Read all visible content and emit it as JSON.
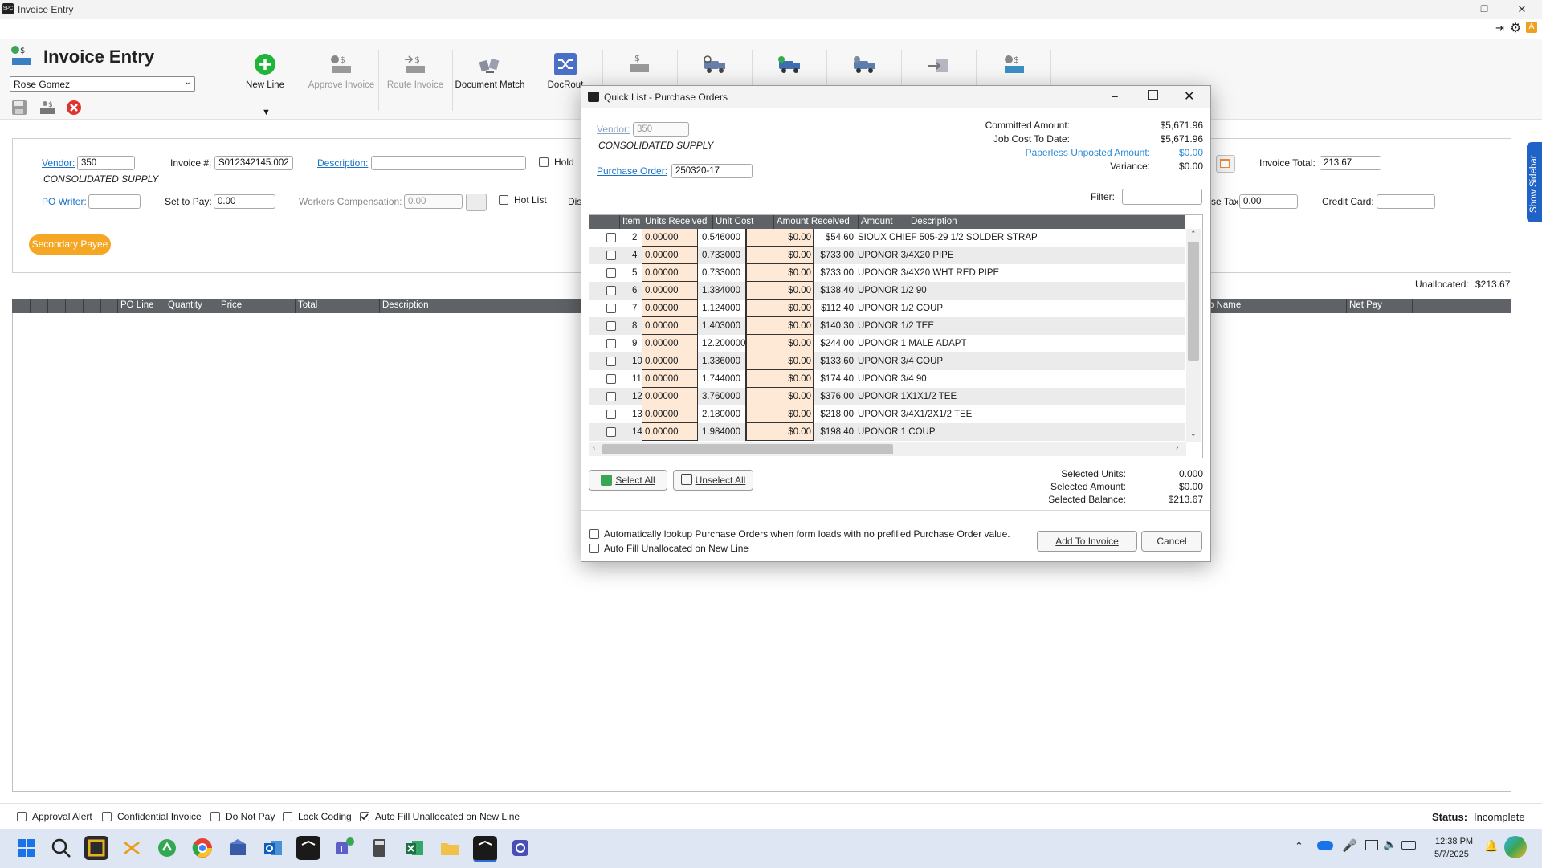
{
  "window": {
    "title": "Invoice Entry"
  },
  "header": {
    "title": "Invoice Entry",
    "user": "Rose Gomez"
  },
  "ribbon": {
    "items": [
      {
        "label": "New Line",
        "icon": "add-circle-icon",
        "enabled": true
      },
      {
        "label": "Approve Invoice",
        "icon": "approve-invoice-icon",
        "enabled": false
      },
      {
        "label": "Route Invoice",
        "icon": "route-invoice-icon",
        "enabled": false
      },
      {
        "label": "Document Match",
        "icon": "document-match-icon",
        "enabled": true
      },
      {
        "label": "DocRout",
        "icon": "shuffle-icon",
        "enabled": true
      }
    ]
  },
  "form": {
    "vendor_label": "Vendor:",
    "vendor": "350",
    "vendor_name": "CONSOLIDATED SUPPLY",
    "invoice_no_label": "Invoice #:",
    "invoice_no": "S012342145.002",
    "description_label": "Description:",
    "description": "",
    "hold_label": "Hold",
    "po_writer_label": "PO Writer:",
    "po_writer": "",
    "set_to_pay_label": "Set to Pay:",
    "set_to_pay": "0.00",
    "workers_comp_label": "Workers Compensation:",
    "workers_comp": "0.00",
    "hot_list_label": "Hot List",
    "dis_label": "Dis",
    "invoice_total_label": "Invoice Total:",
    "invoice_total": "213.67",
    "use_tax_label": "se Tax:",
    "use_tax": "0.00",
    "credit_card_label": "Credit Card:",
    "credit_card": "",
    "secondary_payee": "Secondary Payee",
    "unallocated_label": "Unallocated:",
    "unallocated": "$213.67"
  },
  "grid": {
    "columns": [
      "PO Line",
      "Quantity",
      "Price",
      "Total",
      "Description",
      "b Name",
      "Net Pay"
    ]
  },
  "footer": {
    "checks": [
      {
        "label": "Approval Alert",
        "checked": false
      },
      {
        "label": "Confidential Invoice",
        "checked": false
      },
      {
        "label": "Do Not Pay",
        "checked": false
      },
      {
        "label": "Lock Coding",
        "checked": false
      },
      {
        "label": "Auto Fill Unallocated on New Line",
        "checked": true
      }
    ],
    "status_label": "Status:",
    "status": "Incomplete"
  },
  "sidebar_tab": "Show Sidebar",
  "dialog": {
    "title": "Quick List - Purchase Orders",
    "vendor_label": "Vendor:",
    "vendor": "350",
    "vendor_name": "CONSOLIDATED SUPPLY",
    "po_label": "Purchase Order:",
    "po": "250320-17",
    "summary": [
      {
        "label": "Committed Amount:",
        "value": "$5,671.96"
      },
      {
        "label": "Job Cost To Date:",
        "value": "$5,671.96"
      },
      {
        "label": "Paperless Unposted Amount:",
        "value": "$0.00"
      },
      {
        "label": "Variance:",
        "value": "$0.00"
      }
    ],
    "filter_label": "Filter:",
    "columns": [
      "Item",
      "Units Received",
      "Unit Cost",
      "Amount Received",
      "Amount",
      "Description"
    ],
    "rows": [
      {
        "item": "2",
        "units": "0.00000",
        "cost": "0.546000",
        "recv": "$0.00",
        "amount": "$54.60",
        "desc": "SIOUX CHIEF 505-29 1/2 SOLDER STRAP"
      },
      {
        "item": "4",
        "units": "0.00000",
        "cost": "0.733000",
        "recv": "$0.00",
        "amount": "$733.00",
        "desc": "UPONOR 3/4X20 PIPE"
      },
      {
        "item": "5",
        "units": "0.00000",
        "cost": "0.733000",
        "recv": "$0.00",
        "amount": "$733.00",
        "desc": "UPONOR 3/4X20 WHT RED PIPE"
      },
      {
        "item": "6",
        "units": "0.00000",
        "cost": "1.384000",
        "recv": "$0.00",
        "amount": "$138.40",
        "desc": "UPONOR 1/2 90"
      },
      {
        "item": "7",
        "units": "0.00000",
        "cost": "1.124000",
        "recv": "$0.00",
        "amount": "$112.40",
        "desc": "UPONOR 1/2 COUP"
      },
      {
        "item": "8",
        "units": "0.00000",
        "cost": "1.403000",
        "recv": "$0.00",
        "amount": "$140.30",
        "desc": "UPONOR 1/2 TEE"
      },
      {
        "item": "9",
        "units": "0.00000",
        "cost": "12.200000",
        "recv": "$0.00",
        "amount": "$244.00",
        "desc": "UPONOR 1 MALE ADAPT"
      },
      {
        "item": "10",
        "units": "0.00000",
        "cost": "1.336000",
        "recv": "$0.00",
        "amount": "$133.60",
        "desc": "UPONOR 3/4 COUP"
      },
      {
        "item": "11",
        "units": "0.00000",
        "cost": "1.744000",
        "recv": "$0.00",
        "amount": "$174.40",
        "desc": "UPONOR 3/4 90"
      },
      {
        "item": "12",
        "units": "0.00000",
        "cost": "3.760000",
        "recv": "$0.00",
        "amount": "$376.00",
        "desc": "UPONOR 1X1X1/2 TEE"
      },
      {
        "item": "13",
        "units": "0.00000",
        "cost": "2.180000",
        "recv": "$0.00",
        "amount": "$218.00",
        "desc": "UPONOR 3/4X1/2X1/2 TEE"
      },
      {
        "item": "14",
        "units": "0.00000",
        "cost": "1.984000",
        "recv": "$0.00",
        "amount": "$198.40",
        "desc": "UPONOR 1 COUP"
      }
    ],
    "select_all": "Select All",
    "unselect_all": "Unselect All",
    "selected": [
      {
        "label": "Selected Units:",
        "value": "0.000"
      },
      {
        "label": "Selected Amount:",
        "value": "$0.00"
      },
      {
        "label": "Selected Balance:",
        "value": "$213.67"
      }
    ],
    "opt_auto_lookup": "Automatically lookup Purchase Orders when form loads with no prefilled Purchase Order value.",
    "opt_auto_fill": "Auto Fill Unallocated on New Line",
    "add_to_invoice": "Add To Invoice",
    "cancel": "Cancel"
  },
  "taskbar": {
    "time": "12:38 PM",
    "date": "5/7/2025"
  }
}
